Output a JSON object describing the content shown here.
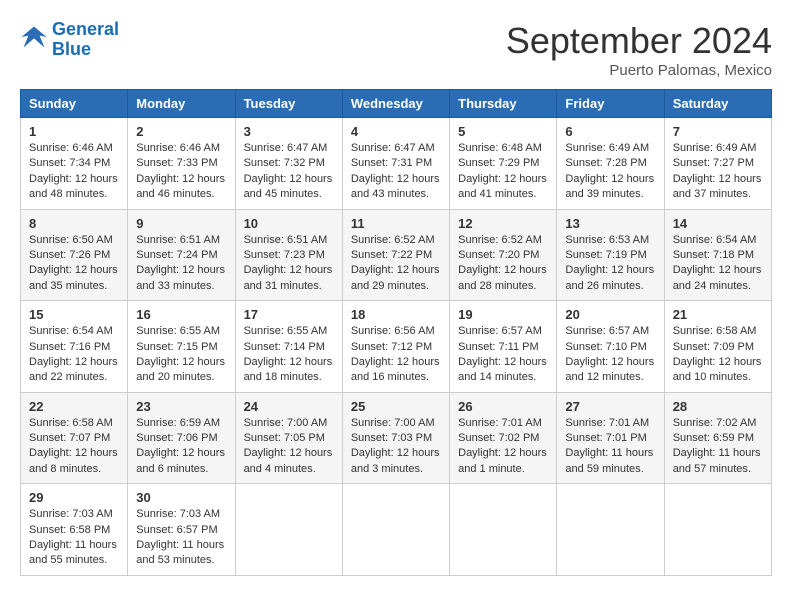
{
  "header": {
    "logo_line1": "General",
    "logo_line2": "Blue",
    "title": "September 2024",
    "subtitle": "Puerto Palomas, Mexico"
  },
  "days": [
    "Sunday",
    "Monday",
    "Tuesday",
    "Wednesday",
    "Thursday",
    "Friday",
    "Saturday"
  ],
  "weeks": [
    [
      {
        "day": "1",
        "sunrise": "6:46 AM",
        "sunset": "7:34 PM",
        "daylight": "12 hours and 48 minutes."
      },
      {
        "day": "2",
        "sunrise": "6:46 AM",
        "sunset": "7:33 PM",
        "daylight": "12 hours and 46 minutes."
      },
      {
        "day": "3",
        "sunrise": "6:47 AM",
        "sunset": "7:32 PM",
        "daylight": "12 hours and 45 minutes."
      },
      {
        "day": "4",
        "sunrise": "6:47 AM",
        "sunset": "7:31 PM",
        "daylight": "12 hours and 43 minutes."
      },
      {
        "day": "5",
        "sunrise": "6:48 AM",
        "sunset": "7:29 PM",
        "daylight": "12 hours and 41 minutes."
      },
      {
        "day": "6",
        "sunrise": "6:49 AM",
        "sunset": "7:28 PM",
        "daylight": "12 hours and 39 minutes."
      },
      {
        "day": "7",
        "sunrise": "6:49 AM",
        "sunset": "7:27 PM",
        "daylight": "12 hours and 37 minutes."
      }
    ],
    [
      {
        "day": "8",
        "sunrise": "6:50 AM",
        "sunset": "7:26 PM",
        "daylight": "12 hours and 35 minutes."
      },
      {
        "day": "9",
        "sunrise": "6:51 AM",
        "sunset": "7:24 PM",
        "daylight": "12 hours and 33 minutes."
      },
      {
        "day": "10",
        "sunrise": "6:51 AM",
        "sunset": "7:23 PM",
        "daylight": "12 hours and 31 minutes."
      },
      {
        "day": "11",
        "sunrise": "6:52 AM",
        "sunset": "7:22 PM",
        "daylight": "12 hours and 29 minutes."
      },
      {
        "day": "12",
        "sunrise": "6:52 AM",
        "sunset": "7:20 PM",
        "daylight": "12 hours and 28 minutes."
      },
      {
        "day": "13",
        "sunrise": "6:53 AM",
        "sunset": "7:19 PM",
        "daylight": "12 hours and 26 minutes."
      },
      {
        "day": "14",
        "sunrise": "6:54 AM",
        "sunset": "7:18 PM",
        "daylight": "12 hours and 24 minutes."
      }
    ],
    [
      {
        "day": "15",
        "sunrise": "6:54 AM",
        "sunset": "7:16 PM",
        "daylight": "12 hours and 22 minutes."
      },
      {
        "day": "16",
        "sunrise": "6:55 AM",
        "sunset": "7:15 PM",
        "daylight": "12 hours and 20 minutes."
      },
      {
        "day": "17",
        "sunrise": "6:55 AM",
        "sunset": "7:14 PM",
        "daylight": "12 hours and 18 minutes."
      },
      {
        "day": "18",
        "sunrise": "6:56 AM",
        "sunset": "7:12 PM",
        "daylight": "12 hours and 16 minutes."
      },
      {
        "day": "19",
        "sunrise": "6:57 AM",
        "sunset": "7:11 PM",
        "daylight": "12 hours and 14 minutes."
      },
      {
        "day": "20",
        "sunrise": "6:57 AM",
        "sunset": "7:10 PM",
        "daylight": "12 hours and 12 minutes."
      },
      {
        "day": "21",
        "sunrise": "6:58 AM",
        "sunset": "7:09 PM",
        "daylight": "12 hours and 10 minutes."
      }
    ],
    [
      {
        "day": "22",
        "sunrise": "6:58 AM",
        "sunset": "7:07 PM",
        "daylight": "12 hours and 8 minutes."
      },
      {
        "day": "23",
        "sunrise": "6:59 AM",
        "sunset": "7:06 PM",
        "daylight": "12 hours and 6 minutes."
      },
      {
        "day": "24",
        "sunrise": "7:00 AM",
        "sunset": "7:05 PM",
        "daylight": "12 hours and 4 minutes."
      },
      {
        "day": "25",
        "sunrise": "7:00 AM",
        "sunset": "7:03 PM",
        "daylight": "12 hours and 3 minutes."
      },
      {
        "day": "26",
        "sunrise": "7:01 AM",
        "sunset": "7:02 PM",
        "daylight": "12 hours and 1 minute."
      },
      {
        "day": "27",
        "sunrise": "7:01 AM",
        "sunset": "7:01 PM",
        "daylight": "11 hours and 59 minutes."
      },
      {
        "day": "28",
        "sunrise": "7:02 AM",
        "sunset": "6:59 PM",
        "daylight": "11 hours and 57 minutes."
      }
    ],
    [
      {
        "day": "29",
        "sunrise": "7:03 AM",
        "sunset": "6:58 PM",
        "daylight": "11 hours and 55 minutes."
      },
      {
        "day": "30",
        "sunrise": "7:03 AM",
        "sunset": "6:57 PM",
        "daylight": "11 hours and 53 minutes."
      },
      null,
      null,
      null,
      null,
      null
    ]
  ]
}
